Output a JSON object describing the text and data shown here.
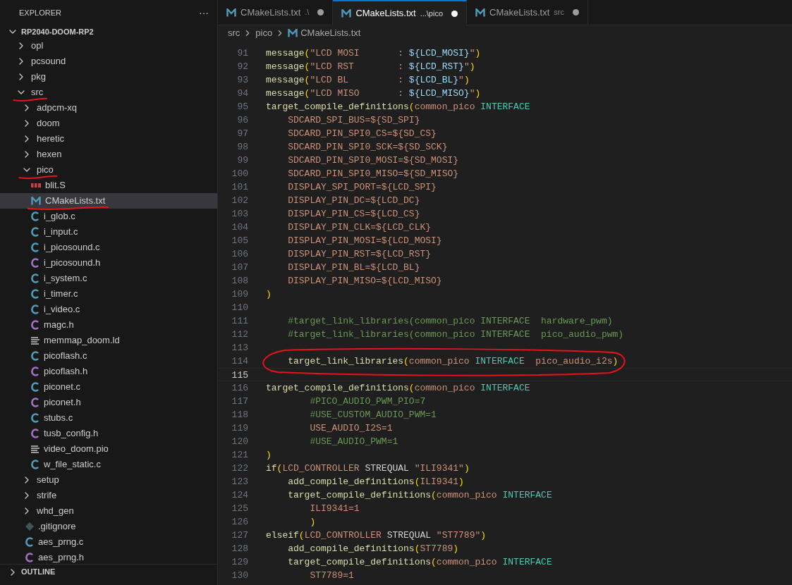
{
  "explorer": {
    "title": "EXPLORER",
    "more_button": "···",
    "root": {
      "name": "RP2040-DOOM-RP2",
      "expanded": true,
      "children": [
        {
          "name": "opl",
          "kind": "folder",
          "expanded": false,
          "selected": false,
          "underlined": false
        },
        {
          "name": "pcsound",
          "kind": "folder",
          "expanded": false,
          "selected": false,
          "underlined": false
        },
        {
          "name": "pkg",
          "kind": "folder",
          "expanded": false,
          "selected": false,
          "underlined": false
        },
        {
          "name": "src",
          "kind": "folder",
          "expanded": true,
          "selected": false,
          "underlined": true,
          "children": [
            {
              "name": "adpcm-xq",
              "kind": "folder",
              "expanded": false,
              "selected": false,
              "underlined": false
            },
            {
              "name": "doom",
              "kind": "folder",
              "expanded": false,
              "selected": false,
              "underlined": false
            },
            {
              "name": "heretic",
              "kind": "folder",
              "expanded": false,
              "selected": false,
              "underlined": false
            },
            {
              "name": "hexen",
              "kind": "folder",
              "expanded": false,
              "selected": false,
              "underlined": false
            },
            {
              "name": "pico",
              "kind": "folder",
              "expanded": true,
              "selected": false,
              "underlined": true,
              "children": [
                {
                  "name": "blit.S",
                  "kind": "asm",
                  "selected": false,
                  "underlined": false
                },
                {
                  "name": "CMakeLists.txt",
                  "kind": "cmake",
                  "selected": true,
                  "underlined": true
                },
                {
                  "name": "i_glob.c",
                  "kind": "c",
                  "selected": false,
                  "underlined": false
                },
                {
                  "name": "i_input.c",
                  "kind": "c",
                  "selected": false,
                  "underlined": false
                },
                {
                  "name": "i_picosound.c",
                  "kind": "c",
                  "selected": false,
                  "underlined": false
                },
                {
                  "name": "i_picosound.h",
                  "kind": "h",
                  "selected": false,
                  "underlined": false
                },
                {
                  "name": "i_system.c",
                  "kind": "c",
                  "selected": false,
                  "underlined": false
                },
                {
                  "name": "i_timer.c",
                  "kind": "c",
                  "selected": false,
                  "underlined": false
                },
                {
                  "name": "i_video.c",
                  "kind": "c",
                  "selected": false,
                  "underlined": false
                },
                {
                  "name": "magc.h",
                  "kind": "h",
                  "selected": false,
                  "underlined": false
                },
                {
                  "name": "memmap_doom.ld",
                  "kind": "text",
                  "selected": false,
                  "underlined": false
                },
                {
                  "name": "picoflash.c",
                  "kind": "c",
                  "selected": false,
                  "underlined": false
                },
                {
                  "name": "picoflash.h",
                  "kind": "h",
                  "selected": false,
                  "underlined": false
                },
                {
                  "name": "piconet.c",
                  "kind": "c",
                  "selected": false,
                  "underlined": false
                },
                {
                  "name": "piconet.h",
                  "kind": "h",
                  "selected": false,
                  "underlined": false
                },
                {
                  "name": "stubs.c",
                  "kind": "c",
                  "selected": false,
                  "underlined": false
                },
                {
                  "name": "tusb_config.h",
                  "kind": "h",
                  "selected": false,
                  "underlined": false
                },
                {
                  "name": "video_doom.pio",
                  "kind": "text",
                  "selected": false,
                  "underlined": false
                },
                {
                  "name": "w_file_static.c",
                  "kind": "c",
                  "selected": false,
                  "underlined": false
                }
              ]
            },
            {
              "name": "setup",
              "kind": "folder",
              "expanded": false,
              "selected": false,
              "underlined": false
            },
            {
              "name": "strife",
              "kind": "folder",
              "expanded": false,
              "selected": false,
              "underlined": false
            },
            {
              "name": "whd_gen",
              "kind": "folder",
              "expanded": false,
              "selected": false,
              "underlined": false
            },
            {
              "name": ".gitignore",
              "kind": "git",
              "selected": false,
              "underlined": false
            },
            {
              "name": "aes_prng.c",
              "kind": "c",
              "selected": false,
              "underlined": false
            },
            {
              "name": "aes_prng.h",
              "kind": "h",
              "selected": false,
              "underlined": false
            }
          ]
        }
      ]
    },
    "sections": [
      {
        "name": "OUTLINE",
        "expanded": false
      }
    ]
  },
  "tabs": [
    {
      "label": "CMakeLists.txt",
      "description": ".\\",
      "selected": false,
      "modified": true
    },
    {
      "label": "CMakeLists.txt",
      "description": "...\\pico",
      "selected": true,
      "modified": true
    },
    {
      "label": "CMakeLists.txt",
      "description": "src",
      "selected": false,
      "modified": true
    }
  ],
  "breadcrumb": [
    {
      "label": "src",
      "kind": "folder"
    },
    {
      "label": "pico",
      "kind": "folder"
    },
    {
      "label": "CMakeLists.txt",
      "kind": "cmake"
    }
  ],
  "code": [
    {
      "number": "91",
      "current": false,
      "circled": false,
      "tokens": [
        {
          "text": "message",
          "kind": "fn"
        },
        {
          "text": "(",
          "kind": "paren"
        },
        {
          "text": "\"LCD MOSI       : ",
          "kind": "str"
        },
        {
          "text": "${LCD_MOSI}",
          "kind": "var"
        },
        {
          "text": "\"",
          "kind": "str"
        },
        {
          "text": ")",
          "kind": "paren"
        }
      ]
    },
    {
      "number": "92",
      "current": false,
      "circled": false,
      "tokens": [
        {
          "text": "message",
          "kind": "fn"
        },
        {
          "text": "(",
          "kind": "paren"
        },
        {
          "text": "\"LCD RST        : ",
          "kind": "str"
        },
        {
          "text": "${LCD_RST}",
          "kind": "var"
        },
        {
          "text": "\"",
          "kind": "str"
        },
        {
          "text": ")",
          "kind": "paren"
        }
      ]
    },
    {
      "number": "93",
      "current": false,
      "circled": false,
      "tokens": [
        {
          "text": "message",
          "kind": "fn"
        },
        {
          "text": "(",
          "kind": "paren"
        },
        {
          "text": "\"LCD BL         : ",
          "kind": "str"
        },
        {
          "text": "${LCD_BL}",
          "kind": "var"
        },
        {
          "text": "\"",
          "kind": "str"
        },
        {
          "text": ")",
          "kind": "paren"
        }
      ]
    },
    {
      "number": "94",
      "current": false,
      "circled": false,
      "tokens": [
        {
          "text": "message",
          "kind": "fn"
        },
        {
          "text": "(",
          "kind": "paren"
        },
        {
          "text": "\"LCD MISO       : ",
          "kind": "str"
        },
        {
          "text": "${LCD_MISO}",
          "kind": "var"
        },
        {
          "text": "\"",
          "kind": "str"
        },
        {
          "text": ")",
          "kind": "paren"
        }
      ]
    },
    {
      "number": "95",
      "current": false,
      "circled": false,
      "tokens": [
        {
          "text": "target_compile_definitions",
          "kind": "fn"
        },
        {
          "text": "(",
          "kind": "paren"
        },
        {
          "text": "common_pico ",
          "kind": "arg"
        },
        {
          "text": "INTERFACE",
          "kind": "kw"
        }
      ]
    },
    {
      "number": "96",
      "current": false,
      "circled": false,
      "tokens": [
        {
          "text": "    SDCARD_SPI_BUS=${SD_SPI}",
          "kind": "arg"
        }
      ]
    },
    {
      "number": "97",
      "current": false,
      "circled": false,
      "tokens": [
        {
          "text": "    SDCARD_PIN_SPI0_CS=${SD_CS}",
          "kind": "arg"
        }
      ]
    },
    {
      "number": "98",
      "current": false,
      "circled": false,
      "tokens": [
        {
          "text": "    SDCARD_PIN_SPI0_SCK=${SD_SCK}",
          "kind": "arg"
        }
      ]
    },
    {
      "number": "99",
      "current": false,
      "circled": false,
      "tokens": [
        {
          "text": "    SDCARD_PIN_SPI0_MOSI=${SD_MOSI}",
          "kind": "arg"
        }
      ]
    },
    {
      "number": "100",
      "current": false,
      "circled": false,
      "tokens": [
        {
          "text": "    SDCARD_PIN_SPI0_MISO=${SD_MISO}",
          "kind": "arg"
        }
      ]
    },
    {
      "number": "101",
      "current": false,
      "circled": false,
      "tokens": [
        {
          "text": "    DISPLAY_SPI_PORT=${LCD_SPI}",
          "kind": "arg"
        }
      ]
    },
    {
      "number": "102",
      "current": false,
      "circled": false,
      "tokens": [
        {
          "text": "    DISPLAY_PIN_DC=${LCD_DC}",
          "kind": "arg"
        }
      ]
    },
    {
      "number": "103",
      "current": false,
      "circled": false,
      "tokens": [
        {
          "text": "    DISPLAY_PIN_CS=${LCD_CS}",
          "kind": "arg"
        }
      ]
    },
    {
      "number": "104",
      "current": false,
      "circled": false,
      "tokens": [
        {
          "text": "    DISPLAY_PIN_CLK=${LCD_CLK}",
          "kind": "arg"
        }
      ]
    },
    {
      "number": "105",
      "current": false,
      "circled": false,
      "tokens": [
        {
          "text": "    DISPLAY_PIN_MOSI=${LCD_MOSI}",
          "kind": "arg"
        }
      ]
    },
    {
      "number": "106",
      "current": false,
      "circled": false,
      "tokens": [
        {
          "text": "    DISPLAY_PIN_RST=${LCD_RST}",
          "kind": "arg"
        }
      ]
    },
    {
      "number": "107",
      "current": false,
      "circled": false,
      "tokens": [
        {
          "text": "    DISPLAY_PIN_BL=${LCD_BL}",
          "kind": "arg"
        }
      ]
    },
    {
      "number": "108",
      "current": false,
      "circled": false,
      "tokens": [
        {
          "text": "    DISPLAY_PIN_MISO=${LCD_MISO}",
          "kind": "arg"
        }
      ]
    },
    {
      "number": "109",
      "current": false,
      "circled": false,
      "tokens": [
        {
          "text": ")",
          "kind": "paren"
        }
      ]
    },
    {
      "number": "110",
      "current": false,
      "circled": false
    },
    {
      "number": "111",
      "current": false,
      "circled": false,
      "tokens": [
        {
          "text": "    #target_link_libraries(common_pico INTERFACE  hardware_pwm)",
          "kind": "com"
        }
      ]
    },
    {
      "number": "112",
      "current": false,
      "circled": false,
      "tokens": [
        {
          "text": "    #target_link_libraries(common_pico INTERFACE  pico_audio_pwm)",
          "kind": "com"
        }
      ]
    },
    {
      "number": "113",
      "current": false,
      "circled": false
    },
    {
      "number": "114",
      "current": false,
      "circled": true,
      "tokens": [
        {
          "text": "    target_link_libraries",
          "kind": "fn"
        },
        {
          "text": "(",
          "kind": "paren"
        },
        {
          "text": "common_pico ",
          "kind": "arg"
        },
        {
          "text": "INTERFACE",
          "kind": "kw"
        },
        {
          "text": "  pico_audio_i2s",
          "kind": "arg"
        },
        {
          "text": ")",
          "kind": "paren"
        }
      ]
    },
    {
      "number": "115",
      "current": true,
      "circled": false
    },
    {
      "number": "116",
      "current": false,
      "circled": false,
      "tokens": [
        {
          "text": "target_compile_definitions",
          "kind": "fn"
        },
        {
          "text": "(",
          "kind": "paren"
        },
        {
          "text": "common_pico ",
          "kind": "arg"
        },
        {
          "text": "INTERFACE",
          "kind": "kw"
        }
      ]
    },
    {
      "number": "117",
      "current": false,
      "circled": false,
      "tokens": [
        {
          "text": "        #PICO_AUDIO_PWM_PIO=7",
          "kind": "com"
        }
      ]
    },
    {
      "number": "118",
      "current": false,
      "circled": false,
      "tokens": [
        {
          "text": "        #USE_CUSTOM_AUDIO_PWM=1",
          "kind": "com"
        }
      ]
    },
    {
      "number": "119",
      "current": false,
      "circled": false,
      "tokens": [
        {
          "text": "        USE_AUDIO_I2S=1",
          "kind": "arg"
        }
      ]
    },
    {
      "number": "120",
      "current": false,
      "circled": false,
      "tokens": [
        {
          "text": "        #USE_AUDIO_PWM=1",
          "kind": "com"
        }
      ]
    },
    {
      "number": "121",
      "current": false,
      "circled": false,
      "tokens": [
        {
          "text": ")",
          "kind": "paren"
        }
      ]
    },
    {
      "number": "122",
      "current": false,
      "circled": false,
      "tokens": [
        {
          "text": "if",
          "kind": "fn"
        },
        {
          "text": "(",
          "kind": "paren"
        },
        {
          "text": "LCD_CONTROLLER",
          "kind": "arg"
        },
        {
          "text": " STREQUAL ",
          "kind": "txt"
        },
        {
          "text": "\"ILI9341\"",
          "kind": "str"
        },
        {
          "text": ")",
          "kind": "paren"
        }
      ]
    },
    {
      "number": "123",
      "current": false,
      "circled": false,
      "tokens": [
        {
          "text": "    add_compile_definitions",
          "kind": "fn"
        },
        {
          "text": "(",
          "kind": "paren"
        },
        {
          "text": "ILI9341",
          "kind": "arg"
        },
        {
          "text": ")",
          "kind": "paren"
        }
      ]
    },
    {
      "number": "124",
      "current": false,
      "circled": false,
      "tokens": [
        {
          "text": "    target_compile_definitions",
          "kind": "fn"
        },
        {
          "text": "(",
          "kind": "paren"
        },
        {
          "text": "common_pico ",
          "kind": "arg"
        },
        {
          "text": "INTERFACE",
          "kind": "kw"
        }
      ]
    },
    {
      "number": "125",
      "current": false,
      "circled": false,
      "tokens": [
        {
          "text": "        ILI9341=1",
          "kind": "arg"
        }
      ]
    },
    {
      "number": "126",
      "current": false,
      "circled": false,
      "tokens": [
        {
          "text": "        )",
          "kind": "paren"
        }
      ]
    },
    {
      "number": "127",
      "current": false,
      "circled": false,
      "tokens": [
        {
          "text": "elseif",
          "kind": "fn"
        },
        {
          "text": "(",
          "kind": "paren"
        },
        {
          "text": "LCD_CONTROLLER",
          "kind": "arg"
        },
        {
          "text": " STREQUAL ",
          "kind": "txt"
        },
        {
          "text": "\"ST7789\"",
          "kind": "str"
        },
        {
          "text": ")",
          "kind": "paren"
        }
      ]
    },
    {
      "number": "128",
      "current": false,
      "circled": false,
      "tokens": [
        {
          "text": "    add_compile_definitions",
          "kind": "fn"
        },
        {
          "text": "(",
          "kind": "paren"
        },
        {
          "text": "ST7789",
          "kind": "arg"
        },
        {
          "text": ")",
          "kind": "paren"
        }
      ]
    },
    {
      "number": "129",
      "current": false,
      "circled": false,
      "tokens": [
        {
          "text": "    target_compile_definitions",
          "kind": "fn"
        },
        {
          "text": "(",
          "kind": "paren"
        },
        {
          "text": "common_pico ",
          "kind": "arg"
        },
        {
          "text": "INTERFACE",
          "kind": "kw"
        }
      ]
    },
    {
      "number": "130",
      "current": false,
      "circled": false,
      "tokens": [
        {
          "text": "        ST7789=1",
          "kind": "arg"
        }
      ]
    }
  ]
}
